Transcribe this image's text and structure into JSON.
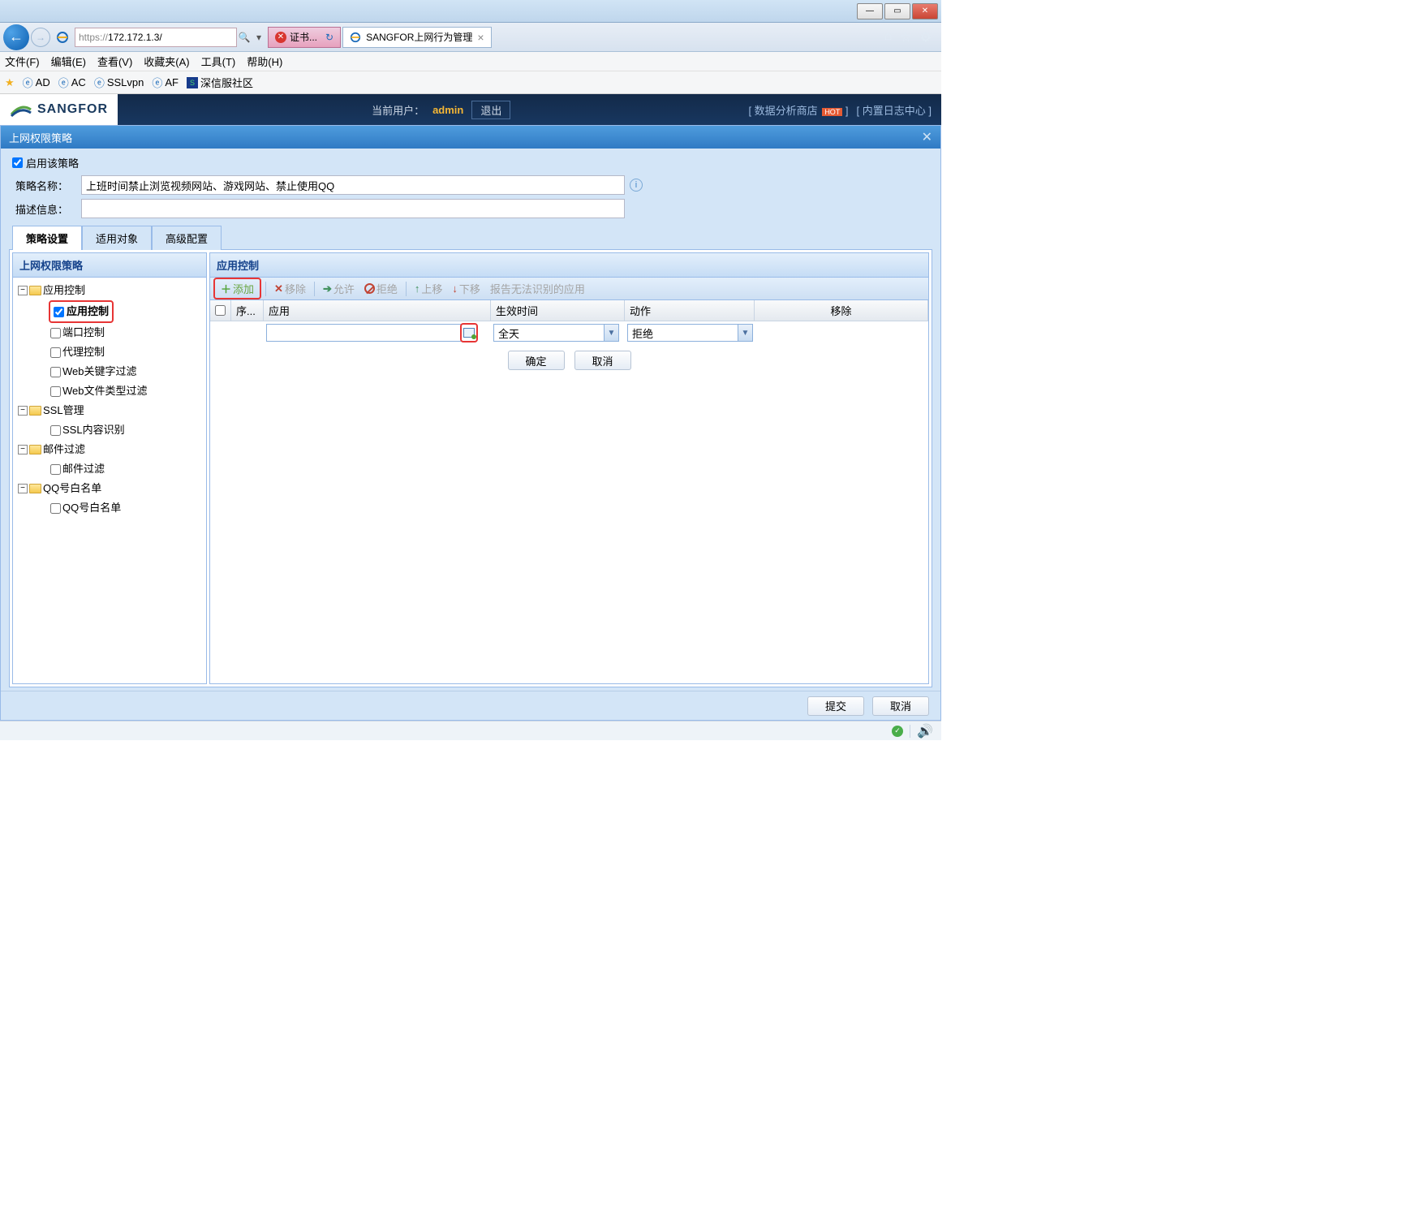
{
  "window": {
    "min": "—",
    "max": "▭",
    "close": "✕"
  },
  "browser": {
    "url_proto": "https://",
    "url_host": "172.172.1.3/",
    "search_icon": "🔍",
    "cert_tab": "证书...",
    "cert_refresh": "↻",
    "page_tab": "SANGFOR上网行为管理",
    "nav_home": "⌂",
    "nav_star": "☆",
    "nav_gear": "⚙"
  },
  "menu": [
    "文件(F)",
    "编辑(E)",
    "查看(V)",
    "收藏夹(A)",
    "工具(T)",
    "帮助(H)"
  ],
  "bookmarks": {
    "star_item": "",
    "items": [
      "AD",
      "AC",
      "SSLvpn",
      "AF"
    ],
    "sangfor_comm": "深信服社区"
  },
  "app_header": {
    "brand": "SANGFOR",
    "current_user_label": "当前用户：",
    "user": "admin",
    "logout": "退出",
    "store": "[ 数据分析商店",
    "hot": "HOT",
    "log_center": "[ 内置日志中心 ]"
  },
  "dialog": {
    "title": "上网权限策略",
    "enable_label": "启用该策略",
    "policy_name_label": "策略名称：",
    "policy_name_value": "上班时间禁止浏览视频网站、游戏网站、禁止使用QQ",
    "desc_label": "描述信息：",
    "desc_value": "",
    "tabs": [
      "策略设置",
      "适用对象",
      "高级配置"
    ]
  },
  "left_tree": {
    "title": "上网权限策略",
    "nodes": {
      "app_ctrl_grp": "应用控制",
      "app_ctrl": "应用控制",
      "port_ctrl": "端口控制",
      "proxy_ctrl": "代理控制",
      "web_kw": "Web关键字过滤",
      "web_ft": "Web文件类型过滤",
      "ssl_grp": "SSL管理",
      "ssl_ident": "SSL内容识别",
      "mail_grp": "邮件过滤",
      "mail_filter": "邮件过滤",
      "qq_grp": "QQ号白名单",
      "qq_list": "QQ号白名单"
    }
  },
  "right_panel": {
    "title": "应用控制",
    "toolbar": {
      "add": "添加",
      "remove": "移除",
      "allow": "允许",
      "deny": "拒绝",
      "moveup": "上移",
      "movedown": "下移",
      "report": "报告无法识别的应用"
    },
    "columns": {
      "seq": "序...",
      "app": "应用",
      "time": "生效时间",
      "action": "动作",
      "remove": "移除"
    },
    "row": {
      "app_value": "",
      "time_value": "全天",
      "action_value": "拒绝"
    },
    "confirm": "确定",
    "cancel": "取消"
  },
  "footer": {
    "submit": "提交",
    "cancel": "取消"
  }
}
